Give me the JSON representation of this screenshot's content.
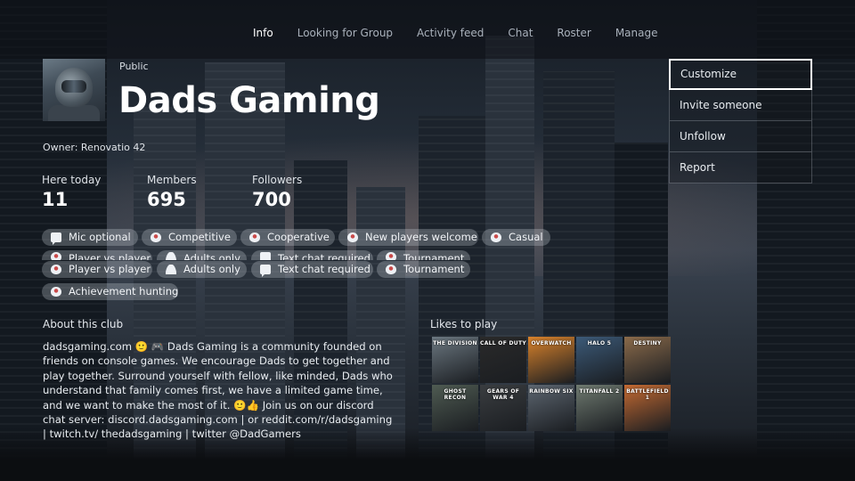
{
  "nav": {
    "tabs": [
      "Info",
      "Looking for Group",
      "Activity feed",
      "Chat",
      "Roster",
      "Manage"
    ]
  },
  "club": {
    "privacy": "Public",
    "name": "Dads Gaming",
    "owner": "Owner: Renovatio 42"
  },
  "stats": [
    {
      "label": "Here today",
      "value": "11"
    },
    {
      "label": "Members",
      "value": "695"
    },
    {
      "label": "Followers",
      "value": "700"
    }
  ],
  "actions": [
    "Customize",
    "Invite someone",
    "Unfollow",
    "Report"
  ],
  "tags": {
    "row1": [
      {
        "label": "Mic optional",
        "icon": "chat-icon"
      },
      {
        "label": "Competitive",
        "icon": "controller-icon"
      },
      {
        "label": "Cooperative",
        "icon": "controller-icon"
      },
      {
        "label": "New players welcome",
        "icon": "controller-icon"
      },
      {
        "label": "Casual",
        "icon": "controller-icon"
      }
    ],
    "row2_partial": [
      {
        "label": "Player vs player",
        "icon": "controller-icon"
      },
      {
        "label": "Adults only",
        "icon": "people-icon"
      },
      {
        "label": "Text chat required",
        "icon": "chat-icon"
      },
      {
        "label": "Tournament",
        "icon": "controller-icon"
      }
    ],
    "row3": [
      {
        "label": "Player vs player",
        "icon": "controller-icon"
      },
      {
        "label": "Adults only",
        "icon": "people-icon"
      },
      {
        "label": "Text chat required",
        "icon": "chat-icon"
      },
      {
        "label": "Tournament",
        "icon": "controller-icon"
      }
    ],
    "row4": [
      {
        "label": "Achievement hunting",
        "icon": "controller-icon"
      }
    ]
  },
  "about": {
    "title": "About this club",
    "text": "dadsgaming.com 🙂 🎮 Dads Gaming is a community founded on friends on console games. We encourage Dads to get together and play together. Surround yourself with fellow, like minded, Dads who understand that family comes first, we have a limited game time, and we want to make the most of it. 🙂👍 Join us on our discord chat server: discord.dadsgaming.com | or reddit.com/r/dadsgaming | twitch.tv/ thedadsgaming | twitter @DadGamers"
  },
  "likes": {
    "title": "Likes to play",
    "games": [
      {
        "title": "THE DIVISION",
        "color": "#6b7780"
      },
      {
        "title": "CALL OF DUTY",
        "color": "#2a2a2a"
      },
      {
        "title": "OVERWATCH",
        "color": "#d9822b"
      },
      {
        "title": "HALO 5",
        "color": "#3c5a78"
      },
      {
        "title": "DESTINY",
        "color": "#8a6a4a"
      },
      {
        "title": "GHOST RECON",
        "color": "#4f5b52"
      },
      {
        "title": "GEARS OF WAR 4",
        "color": "#3a3d40"
      },
      {
        "title": "RAINBOW SIX",
        "color": "#5d6670"
      },
      {
        "title": "TITANFALL 2",
        "color": "#6f7a70"
      },
      {
        "title": "BATTLEFIELD 1",
        "color": "#c46a32"
      }
    ]
  }
}
